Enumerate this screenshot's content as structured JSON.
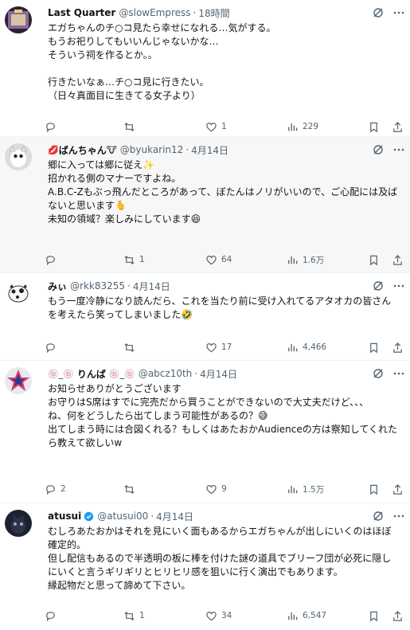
{
  "tweets": [
    {
      "name": "Last Quarter",
      "handle": "@slowEmpress",
      "time": "18時間",
      "text": "エガちゃんのチ○コ見たら幸せになれる…気がする。\nもうお祀りしてもいいんじゃないかな…\nそういう祠を作るとか。。\n\n行きたいなぁ…チ○コ見に行きたい。\n（日々真面目に生きてる女子より）",
      "reply_count": "",
      "retweet_count": "",
      "like_count": "1",
      "view_count": "229"
    },
    {
      "name_prefix_emoji": "💋",
      "name": "ばんちゃん",
      "name_suffix_emoji": "🐮",
      "handle": "@byukarin12",
      "time": "4月14日",
      "text": "郷に入っては郷に従え✨\n招かれる側のマナーですよね。\nA.B.C-Zもぶっ飛んだところがあって、ぼたんはノリがいいので、ご心配には及ばないと思います🫰\n未知の領域？楽しみにしています😆",
      "reply_count": "",
      "retweet_count": "1",
      "like_count": "64",
      "view_count": "1.6万"
    },
    {
      "name": "みぃ",
      "handle": "@rkk83255",
      "time": "4月14日",
      "text": "もう一度冷静になり読んだら、これを当たり前に受け入れてるアタオカの皆さんを考えたら笑ってしまいました🤣",
      "reply_count": "",
      "retweet_count": "",
      "like_count": "17",
      "view_count": "4,466"
    },
    {
      "name_prefix_emoji": "🍥_🍥",
      "name": "りんば",
      "name_suffix_emoji": "🍥_🍥",
      "handle": "@abcz10th",
      "time": "4月14日",
      "text": "お知らせありがとうございます\nお守りはS席はすでに完売だから買うことができないので大丈夫だけど、、、\nね、何をどうしたら出てしまう可能性があるの？😅\n出てしまう時には合図くれる？もしくはあたおかAudienceの方は察知してくれたら教えて欲しいw",
      "reply_count": "2",
      "retweet_count": "",
      "like_count": "9",
      "view_count": "1.5万"
    },
    {
      "name": "atusui",
      "handle": "@atusui00",
      "time": "4月14日",
      "text": "むしろあたおかはそれを見にいく面もあるからエガちゃんが出しにいくのはほぼ確定的。\n但し配信もあるので半透明の板に棒を付けた謎の道具でブリーフ団が必死に隠しにいくと言うギリギリとヒリヒリ感を狙いに行く演出でもあります。\n縁起物だと思って諦めて下さい。",
      "reply_count": "",
      "retweet_count": "1",
      "like_count": "34",
      "view_count": "6,547"
    }
  ],
  "colors": {
    "text": "#0f1419",
    "secondary": "#536471",
    "divider": "#eff3f4",
    "verified": "#1d9bf0",
    "shaded_row": "#f7f7f7"
  },
  "icons": [
    "reply-icon",
    "retweet-icon",
    "like-icon",
    "views-icon",
    "bookmark-icon",
    "share-icon",
    "grok-icon",
    "more-icon",
    "verified-icon"
  ]
}
